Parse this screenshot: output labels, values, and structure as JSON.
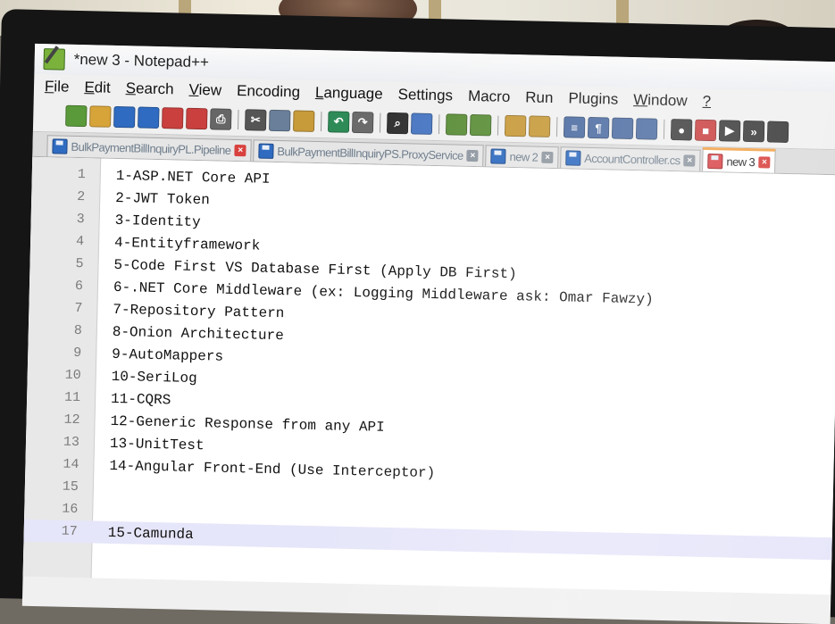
{
  "window": {
    "title": "*new 3 - Notepad++"
  },
  "menu": [
    {
      "label": "File",
      "mnemonic": "F",
      "rest": "ile"
    },
    {
      "label": "Edit",
      "mnemonic": "E",
      "rest": "dit"
    },
    {
      "label": "Search",
      "mnemonic": "S",
      "rest": "earch"
    },
    {
      "label": "View",
      "mnemonic": "V",
      "rest": "iew"
    },
    {
      "label": "Encoding",
      "mnemonic": "",
      "rest": "Encoding"
    },
    {
      "label": "Language",
      "mnemonic": "L",
      "rest": "anguage"
    },
    {
      "label": "Settings",
      "mnemonic": "",
      "rest": "Settings"
    },
    {
      "label": "Macro",
      "mnemonic": "",
      "rest": "Macro"
    },
    {
      "label": "Run",
      "mnemonic": "",
      "rest": "Run"
    },
    {
      "label": "Plugins",
      "mnemonic": "",
      "rest": "Plugins"
    },
    {
      "label": "Window",
      "mnemonic": "W",
      "rest": "indow"
    },
    {
      "label": "?",
      "mnemonic": "?",
      "rest": ""
    }
  ],
  "toolbar_icons": [
    "new-file-icon",
    "open-file-icon",
    "save-icon",
    "save-all-icon",
    "close-icon",
    "close-all-icon",
    "print-icon",
    "|",
    "cut-icon",
    "copy-icon",
    "paste-icon",
    "|",
    "undo-icon",
    "redo-icon",
    "|",
    "find-icon",
    "replace-icon",
    "|",
    "zoom-in-icon",
    "zoom-out-icon",
    "|",
    "sync-vertical-icon",
    "sync-horizontal-icon",
    "|",
    "word-wrap-icon",
    "show-all-chars-icon",
    "indent-guide-icon",
    "doc-map-icon",
    "|",
    "record-macro-icon",
    "stop-record-icon",
    "play-macro-icon",
    "run-macro-multiple-icon",
    "save-macro-icon"
  ],
  "tabs": [
    {
      "label": "BulkPaymentBillInquiryPL.Pipeline",
      "active": false,
      "modified": false,
      "close_color": "#d8413e"
    },
    {
      "label": "BulkPaymentBillInquiryPS.ProxyService",
      "active": false,
      "modified": false,
      "close_color": "#8f97a0"
    },
    {
      "label": "new 2",
      "active": false,
      "modified": false,
      "close_color": "#8f97a0"
    },
    {
      "label": "AccountController.cs",
      "active": false,
      "modified": false,
      "close_color": "#8f97a0"
    },
    {
      "label": "new 3",
      "active": true,
      "modified": true,
      "close_color": "#d8413e"
    }
  ],
  "editor": {
    "current_line": 17,
    "lines": [
      {
        "num": "1",
        "text": "1-ASP.NET Core API"
      },
      {
        "num": "2",
        "text": "2-JWT Token"
      },
      {
        "num": "3",
        "text": "3-Identity"
      },
      {
        "num": "4",
        "text": "4-Entityframework"
      },
      {
        "num": "5",
        "text": "5-Code First VS Database First (Apply DB First)"
      },
      {
        "num": "6",
        "text": "6-.NET Core Middleware (ex: Logging Middleware ask: Omar Fawzy)"
      },
      {
        "num": "7",
        "text": "7-Repository Pattern"
      },
      {
        "num": "8",
        "text": "8-Onion Architecture"
      },
      {
        "num": "9",
        "text": "9-AutoMappers"
      },
      {
        "num": "10",
        "text": "10-SeriLog"
      },
      {
        "num": "11",
        "text": "11-CQRS"
      },
      {
        "num": "12",
        "text": "12-Generic Response from any API"
      },
      {
        "num": "13",
        "text": "13-UnitTest"
      },
      {
        "num": "14",
        "text": "14-Angular Front-End (Use Interceptor)"
      },
      {
        "num": "15",
        "text": ""
      },
      {
        "num": "16",
        "text": ""
      },
      {
        "num": "17",
        "text": "15-Camunda"
      }
    ]
  },
  "colors": {
    "current_line_highlight": "#e6e6fa",
    "active_tab_accent": "#f2a248",
    "gutter": "#e8e8e8"
  }
}
